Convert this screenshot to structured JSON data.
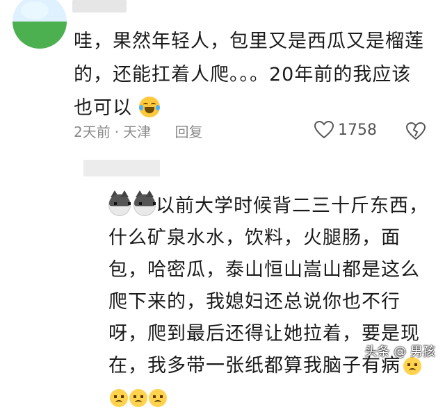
{
  "comment": {
    "text": "哇，果然年轻人，包里又是西瓜又是榴莲的，还能扛着人爬。。。20年前的我应该也可以",
    "time": "2天前",
    "separator": "·",
    "location": "天津",
    "reply_label": "回复",
    "likes": "1758",
    "emoji_icon": "laugh-cry-emoji-icon"
  },
  "reply": {
    "text": "以前大学时候背二三十斤东西，什么矿泉水水，饮料，火腿肠，面包，哈密瓜，泰山恒山嵩山都是这么爬下来的，我媳妇还总说你也不行呀，爬到最后还得让她拉着，要是现在，我多带一张纸都算我脑子有病",
    "lead_icons": [
      "husky-emoji-icon",
      "husky-emoji-icon"
    ],
    "trail_icons": [
      "sad-emoji-icon",
      "sad-emoji-icon",
      "sad-emoji-icon",
      "sad-emoji-icon"
    ]
  },
  "watermark": {
    "text": "头条 @ 男孩"
  },
  "colors": {
    "meta_gray": "#8a8a8a",
    "text": "#1a1a1a",
    "blur": "#e6e6e6"
  }
}
